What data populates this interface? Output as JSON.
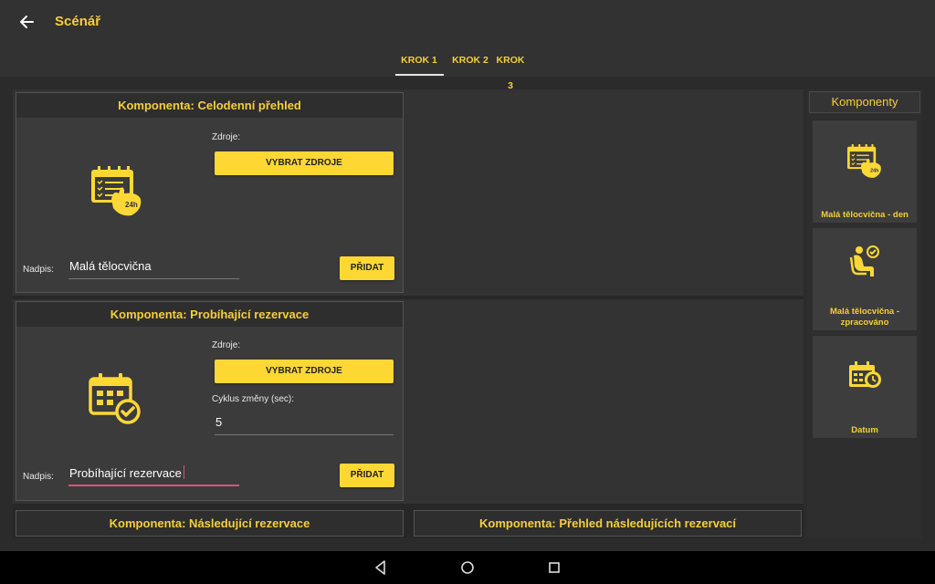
{
  "app": {
    "title": "Scénář"
  },
  "tabs": [
    {
      "label": "KROK 1",
      "active": true
    },
    {
      "label": "KROK 2",
      "active": false
    },
    {
      "label": "KROK 3",
      "active": false
    }
  ],
  "cards": [
    {
      "title": "Komponenta: Celodenní přehled",
      "icon": "calendar-24h-hand-icon",
      "sources_label": "Zdroje:",
      "select_sources_button": "VYBRAT ZDROJE",
      "caption_label": "Nadpis:",
      "caption_value": "Malá tělocvična",
      "add_button": "PŘIDAT"
    },
    {
      "title": "Komponenta: Probíhající rezervace",
      "icon": "calendar-check-icon",
      "sources_label": "Zdroje:",
      "select_sources_button": "VYBRAT ZDROJE",
      "cycle_label": "Cyklus změny (sec):",
      "cycle_value": "5",
      "caption_label": "Nadpis:",
      "caption_value": "Probíhající rezervace",
      "add_button": "PŘIDAT"
    },
    {
      "title": "Komponenta: Následující rezervace"
    },
    {
      "title": "Komponenta: Přehled následujících rezervací"
    }
  ],
  "sidebar": {
    "title": "Komponenty",
    "items": [
      {
        "label": "Malá tělocvična - den",
        "icon": "calendar-24h-hand-icon"
      },
      {
        "label_line1": "Malá tělocvična -",
        "label_line2": "zpracováno",
        "icon": "person-seated-check-icon"
      },
      {
        "label": "Datum",
        "icon": "calendar-clock-icon"
      }
    ]
  },
  "colors": {
    "accent": "#fdd835",
    "accent_text": "#f5cf3a",
    "focus_underline": "#e0507a",
    "background": "#2b2b2b"
  }
}
